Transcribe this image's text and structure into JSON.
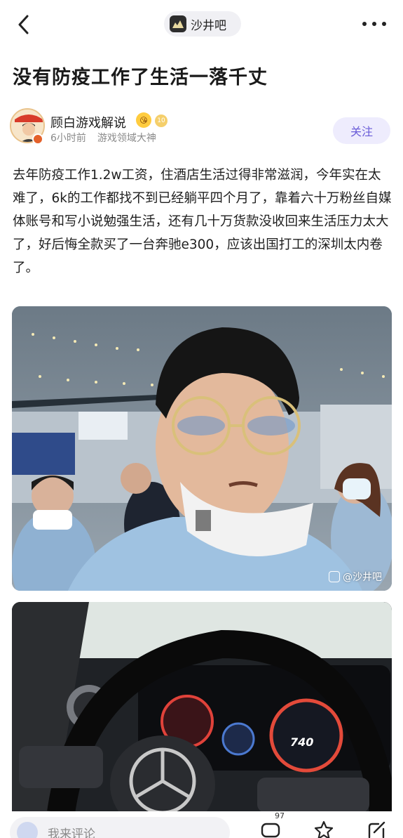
{
  "header": {
    "back_icon": "chevron-left-icon",
    "forum_name": "沙井吧",
    "more_icon": "more-dots-icon"
  },
  "post": {
    "title": "没有防疫工作了生活一落千丈",
    "author": {
      "name": "顾白游戏解说",
      "emoji": "😘",
      "level": "10",
      "time": "6小时前",
      "tag": "游戏领域大神"
    },
    "follow_label": "关注",
    "body": "去年防疫工作1.2w工资，住酒店生活过得非常滋润，今年实在太难了，6k的工作都找不到已经躺平四个月了，靠着六十万粉丝自媒体账号和写小说勉强生活，还有几十万货款没收回来生活压力太大了，好后悔全款买了一台奔驰e300，应该出国打工的深圳太内卷了。",
    "images": [
      {
        "watermark": "@沙井吧"
      },
      {
        "speed_readout": "740"
      }
    ]
  },
  "bottom_bar": {
    "comment_placeholder": "我来评论",
    "comment_count": "97"
  },
  "colors": {
    "accent": "#6a5cd8",
    "follow_bg": "#eeecfd"
  }
}
